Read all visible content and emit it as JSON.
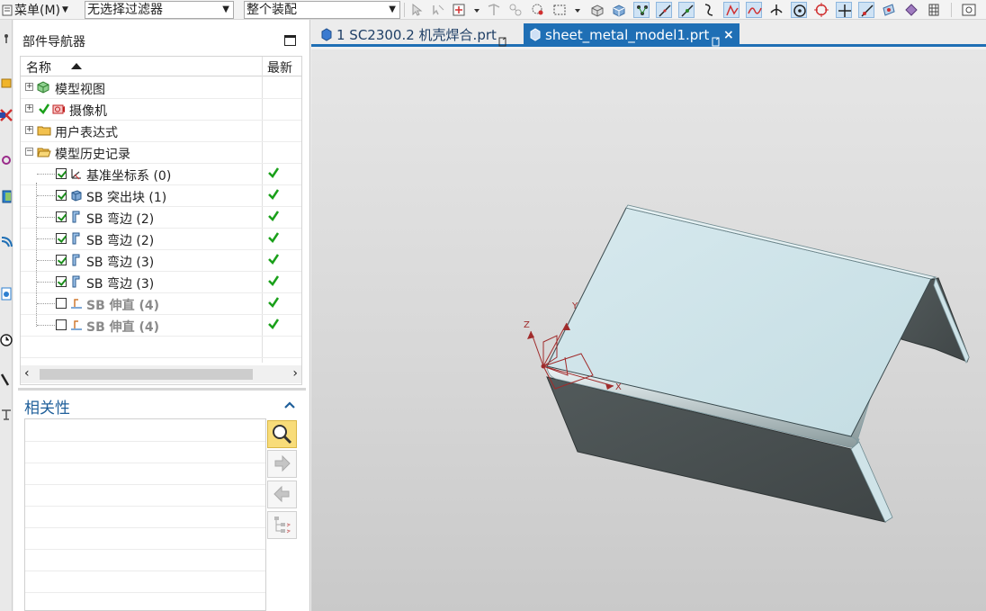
{
  "toolbar": {
    "menu_label": "菜单(M)",
    "filter_value": "无选择过滤器",
    "assembly_value": "整个装配"
  },
  "navigator": {
    "title": "部件导航器",
    "columns": {
      "name": "名称",
      "latest": "最新"
    },
    "items": [
      {
        "label": "模型视图",
        "level": 0,
        "expand": "+",
        "icon": "model-views-icon",
        "checked": null,
        "status": "",
        "latest": false,
        "dim": false
      },
      {
        "label": "摄像机",
        "level": 0,
        "expand": "+",
        "icon": "camera-icon",
        "checked": null,
        "status": "green-check",
        "latest": false,
        "dim": false
      },
      {
        "label": "用户表达式",
        "level": 0,
        "expand": "+",
        "icon": "folder-icon",
        "checked": null,
        "status": "",
        "latest": false,
        "dim": false
      },
      {
        "label": "模型历史记录",
        "level": 0,
        "expand": "-",
        "icon": "folder-open-icon",
        "checked": null,
        "status": "",
        "latest": false,
        "dim": false
      },
      {
        "label": "基准坐标系 (0)",
        "level": 1,
        "expand": "",
        "icon": "datum-csys-icon",
        "checked": true,
        "status": "",
        "latest": true,
        "dim": false
      },
      {
        "label": "SB 突出块 (1)",
        "level": 1,
        "expand": "",
        "icon": "tab-feature-icon",
        "checked": true,
        "status": "",
        "latest": true,
        "dim": false
      },
      {
        "label": "SB 弯边 (2)",
        "level": 1,
        "expand": "",
        "icon": "flange-icon",
        "checked": true,
        "status": "",
        "latest": true,
        "dim": false
      },
      {
        "label": "SB 弯边 (2)",
        "level": 1,
        "expand": "",
        "icon": "flange-icon",
        "checked": true,
        "status": "",
        "latest": true,
        "dim": false
      },
      {
        "label": "SB 弯边 (3)",
        "level": 1,
        "expand": "",
        "icon": "flange-icon",
        "checked": true,
        "status": "",
        "latest": true,
        "dim": false
      },
      {
        "label": "SB 弯边 (3)",
        "level": 1,
        "expand": "",
        "icon": "flange-icon",
        "checked": true,
        "status": "",
        "latest": true,
        "dim": false
      },
      {
        "label": "SB 伸直 (4)",
        "level": 1,
        "expand": "",
        "icon": "unbend-icon",
        "checked": false,
        "status": "",
        "latest": true,
        "dim": true
      },
      {
        "label": "SB 伸直 (4)",
        "level": 1,
        "expand": "",
        "icon": "unbend-icon",
        "checked": false,
        "status": "",
        "latest": true,
        "dim": true
      }
    ]
  },
  "dependencies": {
    "title": "相关性"
  },
  "tabs": [
    {
      "label": "1 SC2300.2 机壳焊合.prt",
      "active": false
    },
    {
      "label": "sheet_metal_model1.prt",
      "active": true
    }
  ],
  "colors": {
    "accent": "#1f6fb5",
    "dependency_title": "#1f5f9a",
    "sheet_top": "#cfe3e8",
    "sheet_side": "#4a5152"
  }
}
